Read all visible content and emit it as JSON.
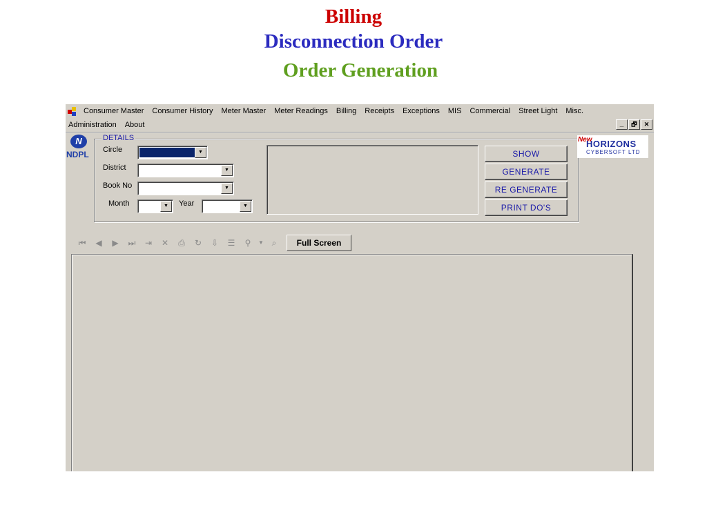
{
  "slide": {
    "title": "Billing",
    "subtitle": "Disconnection Order",
    "section": "Order Generation",
    "title_color": "#cc0000",
    "subtitle_color": "#2b2bbf",
    "section_color": "#5f9f1f"
  },
  "menu": {
    "row1": [
      "Consumer Master",
      "Consumer History",
      "Meter Master",
      "Meter Readings",
      "Billing",
      "Receipts",
      "Exceptions",
      "MIS",
      "Commercial",
      "Street Light",
      "Misc."
    ],
    "row2": [
      "Administration",
      "About"
    ]
  },
  "window_buttons": {
    "minimize": "_",
    "restore": "🗗",
    "close": "✕"
  },
  "logos": {
    "ndpl": "NDPL",
    "horizons_new": "New",
    "horizons": "HORIZONS",
    "horizons_sub": "CYBERSOFT LTD"
  },
  "details": {
    "legend": "DETAILS",
    "circle_label": "Circle",
    "district_label": "District",
    "bookno_label": "Book No",
    "month_label": "Month",
    "year_label": "Year",
    "circle_value": "",
    "district_value": "",
    "bookno_value": "",
    "month_value": "",
    "year_value": "",
    "circle_highlight_color": "#0a246a"
  },
  "actions": {
    "show": "SHOW",
    "generate": "GENERATE",
    "regenerate": "RE GENERATE",
    "print": "PRINT DO'S"
  },
  "toolbar": {
    "full_screen": "Full Screen",
    "icons": [
      "first-page-icon",
      "prev-page-icon",
      "next-page-icon",
      "last-page-icon",
      "goto-page-icon",
      "stop-icon",
      "print-icon",
      "refresh-icon",
      "export-icon",
      "group-tree-icon",
      "zoom-icon",
      "dropdown-icon",
      "search-icon"
    ]
  }
}
